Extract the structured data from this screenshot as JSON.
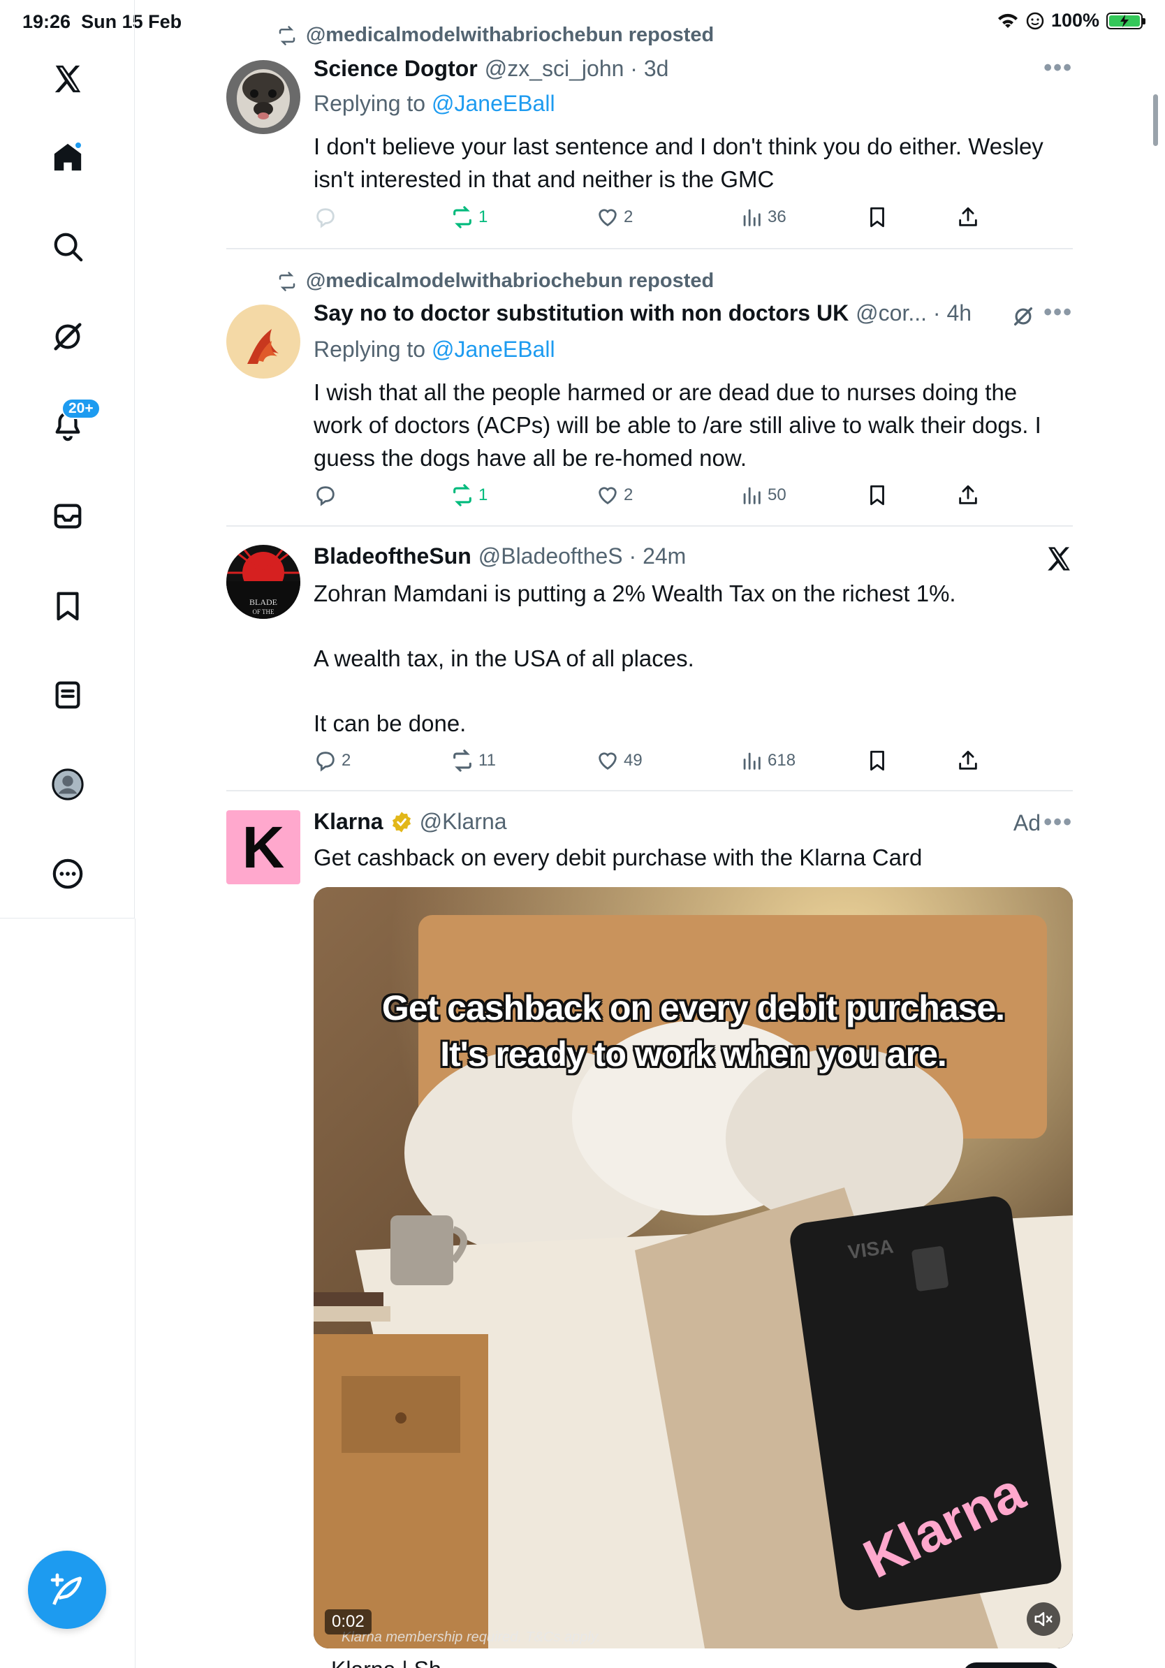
{
  "status_bar": {
    "time": "19:26",
    "date": "Sun 15 Feb",
    "battery": "100%"
  },
  "sidebar": {
    "items": [
      {
        "name": "x-logo",
        "label": "X"
      },
      {
        "name": "home",
        "label": "Home"
      },
      {
        "name": "search",
        "label": "Search"
      },
      {
        "name": "grok",
        "label": "Grok"
      },
      {
        "name": "notifications",
        "label": "Notifications",
        "badge": "20+"
      },
      {
        "name": "messages",
        "label": "Messages"
      },
      {
        "name": "bookmarks",
        "label": "Bookmarks"
      },
      {
        "name": "lists",
        "label": "Lists"
      },
      {
        "name": "profile",
        "label": "Profile"
      },
      {
        "name": "more",
        "label": "More"
      }
    ],
    "notification_badge": "20+"
  },
  "posts": [
    {
      "reposted_by": "@medicalmodelwithabriochebun reposted",
      "name": "Science Dogtor",
      "handle": "@zx_sci_john",
      "time": "3d",
      "replying_prefix": "Replying to",
      "replying_to": "@JaneEBall",
      "text": "I don't believe your last sentence and I don't think you do either. Wesley isn't interested in that and neither is the GMC",
      "replies": "",
      "reposts": "1",
      "likes": "2",
      "views": "36"
    },
    {
      "reposted_by": "@medicalmodelwithabriochebun reposted",
      "name": "Say no to doctor substitution with non doctors UK",
      "handle": "@cor...",
      "time": "4h",
      "replying_prefix": "Replying to",
      "replying_to": "@JaneEBall",
      "text_lines": [
        "I wish that all the people harmed or are dead due to nurses doing the",
        "work of doctors (ACPs) will be able to /are still alive to walk their dogs. I",
        "guess the dogs have all be re-homed  now."
      ],
      "replies": "",
      "reposts": "1",
      "likes": "2",
      "views": "50"
    },
    {
      "name": "BladeoftheSun",
      "handle": "@BladeoftheS",
      "time": "24m",
      "text_lines": [
        "Zohran Mamdani is putting a 2% Wealth Tax on the richest 1%.",
        "",
        "A wealth tax, in the USA of all places.",
        "",
        "It can be done."
      ],
      "replies": "2",
      "reposts": "11",
      "likes": "49",
      "views": "618"
    }
  ],
  "ad": {
    "name": "Klarna",
    "handle": "@Klarna",
    "ad_label": "Ad",
    "text": "Get cashback on every debit purchase with the Klarna Card",
    "logo_letter": "K",
    "video": {
      "caption_line1": "Get cashback on every debit purchase.",
      "caption_line2": "It's ready to work when you are.",
      "time": "0:02",
      "fine_print": "Klarna membership required. T&Cs apply.",
      "card_brand": "Klarna",
      "card_network": "VISA"
    },
    "cut_text": "Klarna | Sh..."
  },
  "colors": {
    "accent": "#1d9bf0",
    "repost_green": "#00ba7c",
    "secondary_text": "#536471",
    "klarna_pink": "#ffa8cd"
  }
}
